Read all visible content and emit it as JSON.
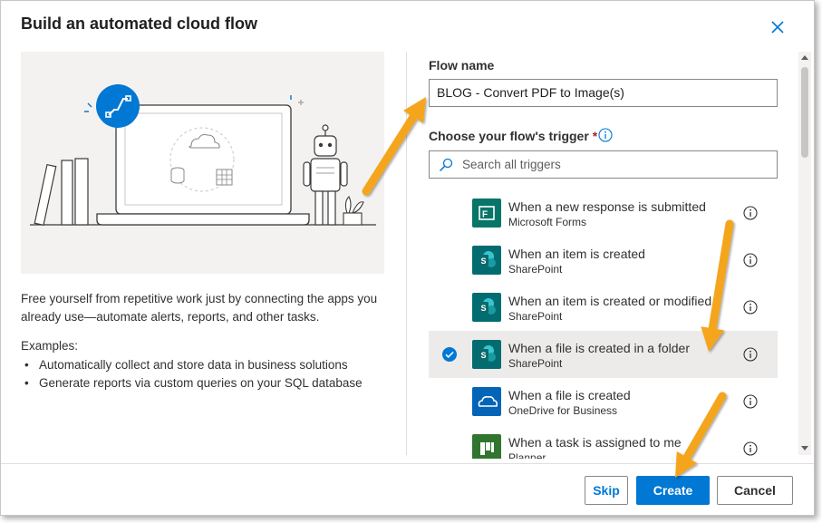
{
  "dialog": {
    "title": "Build an automated cloud flow",
    "close_icon": "close-icon"
  },
  "left": {
    "description": "Free yourself from repetitive work just by connecting the apps you already use—automate alerts, reports, and other tasks.",
    "examples_label": "Examples:",
    "examples": [
      "Automatically collect and store data in business solutions",
      "Generate reports via custom queries on your SQL database"
    ]
  },
  "form": {
    "flow_name_label": "Flow name",
    "flow_name_value": "BLOG - Convert PDF to Image(s)",
    "trigger_label": "Choose your flow's trigger",
    "required_mark": "*",
    "search_placeholder": "Search all triggers"
  },
  "triggers": [
    {
      "name": "When a new response is submitted",
      "connector": "Microsoft Forms",
      "icon": "forms-icon",
      "color": "#077568",
      "selected": false
    },
    {
      "name": "When an item is created",
      "connector": "SharePoint",
      "icon": "sharepoint-icon",
      "color": "#036c70",
      "selected": false
    },
    {
      "name": "When an item is created or modified",
      "connector": "SharePoint",
      "icon": "sharepoint-icon",
      "color": "#036c70",
      "selected": false
    },
    {
      "name": "When a file is created in a folder",
      "connector": "SharePoint",
      "icon": "sharepoint-icon",
      "color": "#036c70",
      "selected": true
    },
    {
      "name": "When a file is created",
      "connector": "OneDrive for Business",
      "icon": "onedrive-icon",
      "color": "#0364b8",
      "selected": false
    },
    {
      "name": "When a task is assigned to me",
      "connector": "Planner",
      "icon": "planner-icon",
      "color": "#31752f",
      "selected": false
    }
  ],
  "footer": {
    "skip_label": "Skip",
    "create_label": "Create",
    "cancel_label": "Cancel"
  },
  "colors": {
    "accent": "#0078d4",
    "annotation_arrow": "#f4a51c"
  }
}
